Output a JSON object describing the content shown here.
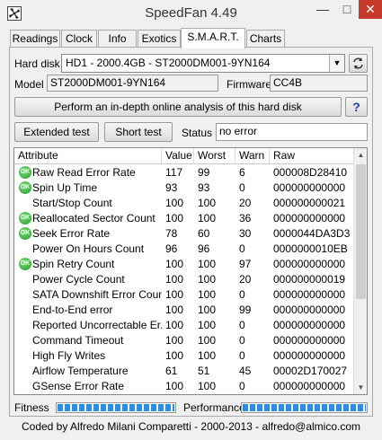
{
  "window": {
    "title": "SpeedFan 4.49"
  },
  "tabs": [
    {
      "label": "Readings"
    },
    {
      "label": "Clock"
    },
    {
      "label": "Info"
    },
    {
      "label": "Exotics"
    },
    {
      "label": "S.M.A.R.T."
    },
    {
      "label": "Charts"
    }
  ],
  "active_tab": "S.M.A.R.T.",
  "disk": {
    "hard_disk_label": "Hard disk",
    "hard_disk_value": "HD1 - 2000.4GB - ST2000DM001-9YN164",
    "model_label": "Model",
    "model_value": "ST2000DM001-9YN164",
    "firmware_label": "Firmware",
    "firmware_value": "CC4B"
  },
  "buttons": {
    "analysis": "Perform an in-depth online analysis of this hard disk",
    "help": "?",
    "extended_test": "Extended test",
    "short_test": "Short test"
  },
  "status": {
    "label": "Status",
    "value": "no error"
  },
  "table": {
    "headers": [
      "Attribute",
      "Value",
      "Worst",
      "Warn",
      "Raw"
    ],
    "rows": [
      {
        "ok": true,
        "attribute": "Raw Read Error Rate",
        "value": "117",
        "worst": "99",
        "warn": "6",
        "raw": "000008D28410"
      },
      {
        "ok": true,
        "attribute": "Spin Up Time",
        "value": "93",
        "worst": "93",
        "warn": "0",
        "raw": "000000000000"
      },
      {
        "ok": false,
        "attribute": "Start/Stop Count",
        "value": "100",
        "worst": "100",
        "warn": "20",
        "raw": "000000000021"
      },
      {
        "ok": true,
        "attribute": "Reallocated Sector Count",
        "value": "100",
        "worst": "100",
        "warn": "36",
        "raw": "000000000000"
      },
      {
        "ok": true,
        "attribute": "Seek Error Rate",
        "value": "78",
        "worst": "60",
        "warn": "30",
        "raw": "0000044DA3D3"
      },
      {
        "ok": false,
        "attribute": "Power On Hours Count",
        "value": "96",
        "worst": "96",
        "warn": "0",
        "raw": "0000000010EB"
      },
      {
        "ok": true,
        "attribute": "Spin Retry Count",
        "value": "100",
        "worst": "100",
        "warn": "97",
        "raw": "000000000000"
      },
      {
        "ok": false,
        "attribute": "Power Cycle Count",
        "value": "100",
        "worst": "100",
        "warn": "20",
        "raw": "000000000019"
      },
      {
        "ok": false,
        "attribute": "SATA Downshift Error Count",
        "value": "100",
        "worst": "100",
        "warn": "0",
        "raw": "000000000000"
      },
      {
        "ok": false,
        "attribute": "End-to-End error",
        "value": "100",
        "worst": "100",
        "warn": "99",
        "raw": "000000000000"
      },
      {
        "ok": false,
        "attribute": "Reported Uncorrectable Er...",
        "value": "100",
        "worst": "100",
        "warn": "0",
        "raw": "000000000000"
      },
      {
        "ok": false,
        "attribute": "Command Timeout",
        "value": "100",
        "worst": "100",
        "warn": "0",
        "raw": "000000000000"
      },
      {
        "ok": false,
        "attribute": "High Fly Writes",
        "value": "100",
        "worst": "100",
        "warn": "0",
        "raw": "000000000000"
      },
      {
        "ok": false,
        "attribute": "Airflow Temperature",
        "value": "61",
        "worst": "51",
        "warn": "45",
        "raw": "00002D170027"
      },
      {
        "ok": false,
        "attribute": "GSense Error Rate",
        "value": "100",
        "worst": "100",
        "warn": "0",
        "raw": "000000000000"
      }
    ],
    "ok_icon_text": "OK"
  },
  "fitness": {
    "label": "Fitness",
    "level": 1.0
  },
  "performance": {
    "label": "Performance",
    "level": 1.0
  },
  "footer": "Coded by Alfredo Milani Comparetti - 2000-2013 - alfredo@almico.com",
  "colors": {
    "accent": "#2a8de0",
    "ok_green": "#1f9a1f",
    "close_red": "#c7392a"
  }
}
